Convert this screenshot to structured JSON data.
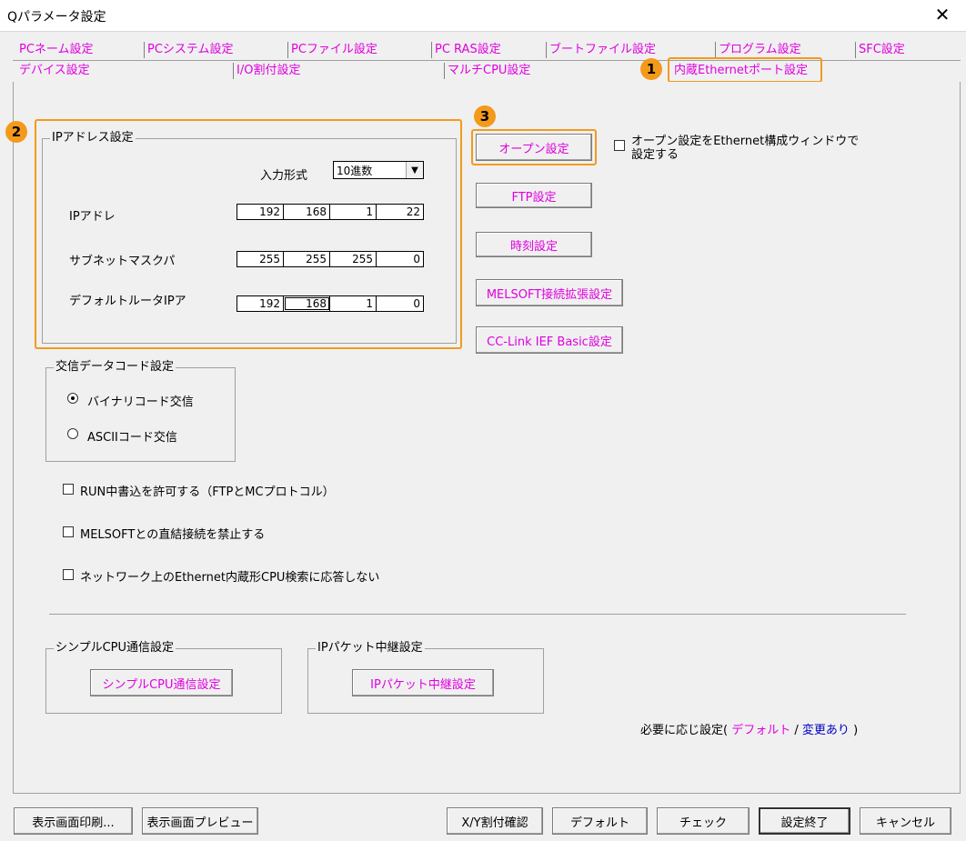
{
  "window": {
    "title": "Qパラメータ設定",
    "close": "✕"
  },
  "tabs_row1": [
    "PCネーム設定",
    "PCシステム設定",
    "PCファイル設定",
    "PC RAS設定",
    "ブートファイル設定",
    "プログラム設定",
    "SFC設定"
  ],
  "tabs_row2": [
    "デバイス設定",
    "I/O割付設定",
    "マルチCPU設定",
    "内蔵Ethernetポート設定"
  ],
  "badges": [
    "1",
    "2",
    "3"
  ],
  "ip_group": {
    "legend": "IPアドレス設定",
    "input_format_label": "入力形式",
    "input_format_value": "10進数",
    "ip_label": "IPアドレ",
    "ip": [
      "192",
      "168",
      "1",
      "22"
    ],
    "subnet_label": "サブネットマスクパ",
    "subnet": [
      "255",
      "255",
      "255",
      "0"
    ],
    "gateway_label": "デフォルトルータIPア",
    "gateway": [
      "192",
      "168",
      "1",
      "0"
    ]
  },
  "buttons": {
    "open": "オープン設定",
    "ftp": "FTP設定",
    "time": "時刻設定",
    "melsoft": "MELSOFT接続拡張設定",
    "cclink": "CC-Link IEF Basic設定"
  },
  "open_ethernet_checkbox": {
    "line1": "オープン設定をEthernet構成ウィンドウで",
    "line2": "設定する"
  },
  "code_group": {
    "legend": "交信データコード設定",
    "binary": "バイナリコード交信",
    "ascii": "ASCIIコード交信"
  },
  "checks": {
    "run_write": "RUN中書込を許可する（FTPとMCプロトコル）",
    "melsoft_direct": "MELSOFTとの直結接続を禁止する",
    "network_search": "ネットワーク上のEthernet内蔵形CPU検索に応答しない"
  },
  "simple_cpu": {
    "legend": "シンプルCPU通信設定",
    "button": "シンプルCPU通信設定"
  },
  "ip_packet": {
    "legend": "IPパケット中継設定",
    "button": "IPパケット中継設定"
  },
  "legend_note": {
    "prefix": "必要に応じ設定(",
    "default": "デフォルト",
    "slash": "/",
    "changed": "変更あり",
    "suffix": ")"
  },
  "bottom_buttons": {
    "print": "表示画面印刷...",
    "preview": "表示画面プレビュー",
    "xy": "X/Y割付確認",
    "default": "デフォルト",
    "check": "チェック",
    "finish": "設定終了",
    "cancel": "キャンセル"
  }
}
